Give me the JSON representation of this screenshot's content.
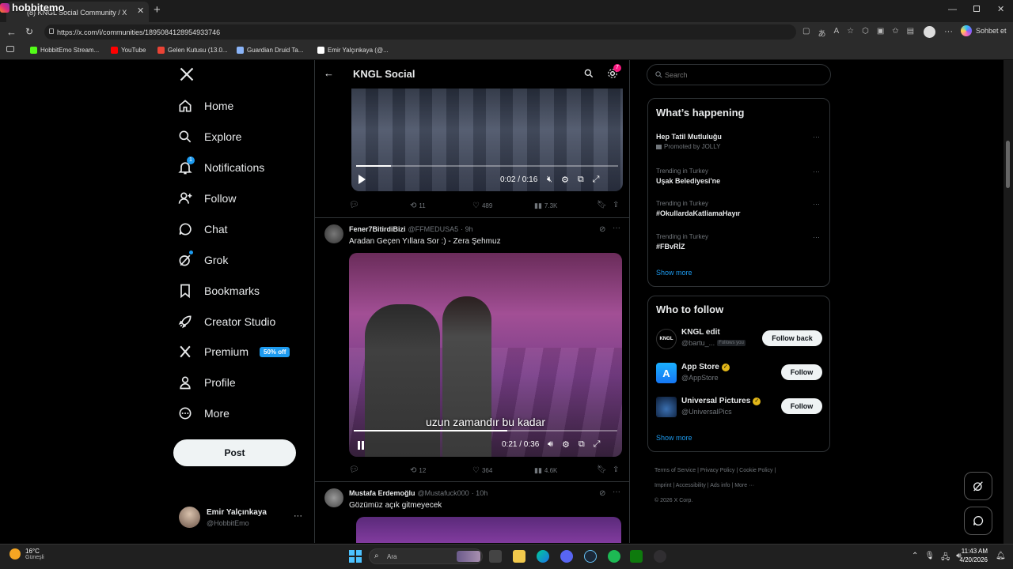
{
  "browser": {
    "profile_overlay": "hobbitemo",
    "tab_title": "(8) KNGL Social Community / X",
    "url": "https://x.com/i/communities/1895084128954933746",
    "copilot_label": "Sohbet et",
    "favorites": [
      {
        "label": "HobbitEmo Stream...",
        "color": "#53fc18"
      },
      {
        "label": "YouTube",
        "color": "#ff0000"
      },
      {
        "label": "Gelen Kutusu (13.0...",
        "color": "#ea4335"
      },
      {
        "label": "Guardian Druid Ta...",
        "color": "#8ab4f8"
      },
      {
        "label": "Emir Yalçınkaya (@...",
        "color": "#ffffff"
      }
    ]
  },
  "nav": {
    "items": [
      {
        "label": "Home",
        "icon": "home-icon"
      },
      {
        "label": "Explore",
        "icon": "search-icon"
      },
      {
        "label": "Notifications",
        "icon": "bell-icon",
        "badge": "1"
      },
      {
        "label": "Follow",
        "icon": "person-add-icon"
      },
      {
        "label": "Chat",
        "icon": "chat-icon"
      },
      {
        "label": "Grok",
        "icon": "grok-icon"
      },
      {
        "label": "Bookmarks",
        "icon": "bookmark-icon"
      },
      {
        "label": "Creator Studio",
        "icon": "rocket-icon"
      },
      {
        "label": "Premium",
        "icon": "x-icon",
        "badge": "50% off"
      },
      {
        "label": "Profile",
        "icon": "person-icon"
      },
      {
        "label": "More",
        "icon": "more-circle-icon"
      }
    ],
    "post_label": "Post",
    "account_name": "Emir Yalçınkaya",
    "account_handle": "@HobbitEmo"
  },
  "header": {
    "title": "KNGL Social",
    "settings_badge": "7"
  },
  "posts": [
    {
      "video_time": "0:02 / 0:16",
      "replies": "",
      "reposts": "11",
      "likes": "489",
      "views": "7.3K"
    },
    {
      "author": "Fener7BitirdiBizi",
      "handle": "@FFMEDUSA5",
      "time": "· 9h",
      "text": "Aradan Geçen Yıllara Sor :) - Zera Şehmuz",
      "video_caption": "uzun zamandır bu kadar",
      "video_time": "0:21 / 0:36",
      "reposts": "12",
      "likes": "364",
      "views": "4.6K"
    },
    {
      "author": "Mustafa Erdemoğlu",
      "handle": "@Mustafuck000",
      "time": "· 10h",
      "text": "Gözümüz açık gitmeyecek"
    }
  ],
  "search": {
    "placeholder": "Search"
  },
  "whats_happening": {
    "title": "What’s happening",
    "trends": [
      {
        "context": "",
        "name": "Hep Tatil Mutluluğu",
        "promoted": "Promoted by JOLLY"
      },
      {
        "context": "Trending in Turkey",
        "name": "Uşak Belediyesi'ne"
      },
      {
        "context": "Trending in Turkey",
        "name": "#OkullardaKatliamaHayır"
      },
      {
        "context": "Trending in Turkey",
        "name": "#FBvRİZ"
      }
    ],
    "show_more": "Show more"
  },
  "who_to_follow": {
    "title": "Who to follow",
    "accounts": [
      {
        "name": "KNGL edit",
        "handle": "@bartu_...",
        "note": "Follows you",
        "button": "Follow back",
        "avatar_text": "KNGL"
      },
      {
        "name": "App Store",
        "handle": "@AppStore",
        "button": "Follow",
        "verified": true
      },
      {
        "name": "Universal Pictures",
        "handle": "@UniversalPics",
        "button": "Follow",
        "verified": true
      }
    ],
    "show_more": "Show more"
  },
  "footer": {
    "links": [
      "Terms of Service",
      "Privacy Policy",
      "Cookie Policy",
      "Imprint",
      "Accessibility",
      "Ads info",
      "More ···"
    ],
    "copyright": "© 2026 X Corp."
  },
  "taskbar": {
    "weather_temp": "16°C",
    "weather_desc": "Güneşli",
    "search_label": "Ara",
    "time": "11:43 AM",
    "date": "4/20/2026"
  }
}
